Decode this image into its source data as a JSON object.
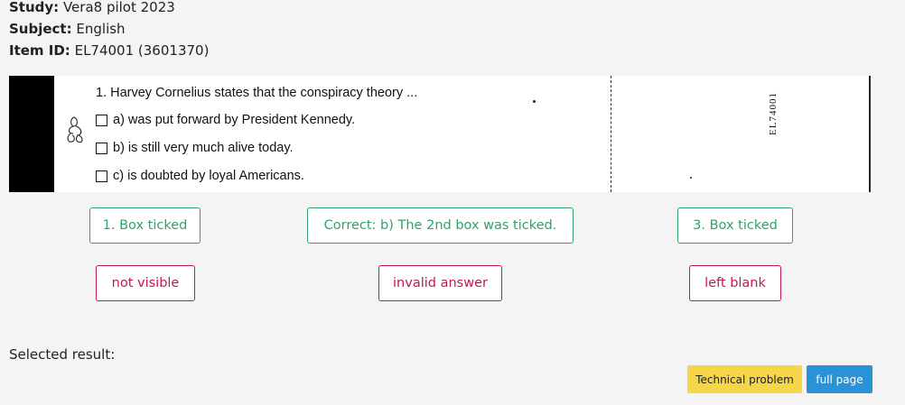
{
  "meta": {
    "study_label": "Study:",
    "study_value": "Vera8 pilot 2023",
    "subject_label": "Subject:",
    "subject_value": "English",
    "item_label": "Item ID:",
    "item_value": "EL74001 (3601370)"
  },
  "scan": {
    "question": "1. Harvey Cornelius states that the conspiracy theory ...",
    "options": [
      "a) was put forward by President Kennedy.",
      "b) is still very much alive today.",
      "c) is doubted by loyal Americans."
    ],
    "item_code": "EL74001"
  },
  "answers": {
    "box1": "1. Box ticked",
    "correct": "Correct: b) The 2nd box was ticked.",
    "box3": "3. Box ticked",
    "not_visible": "not visible",
    "invalid": "invalid answer",
    "blank": "left blank"
  },
  "selected_label": "Selected result:",
  "footer": {
    "technical": "Technical problem",
    "full_page": "full page"
  },
  "colors": {
    "correct_green": "#2ea36a",
    "error_red": "#c8154a",
    "warning_yellow": "#f5d64a",
    "primary_blue": "#2a93d8"
  }
}
